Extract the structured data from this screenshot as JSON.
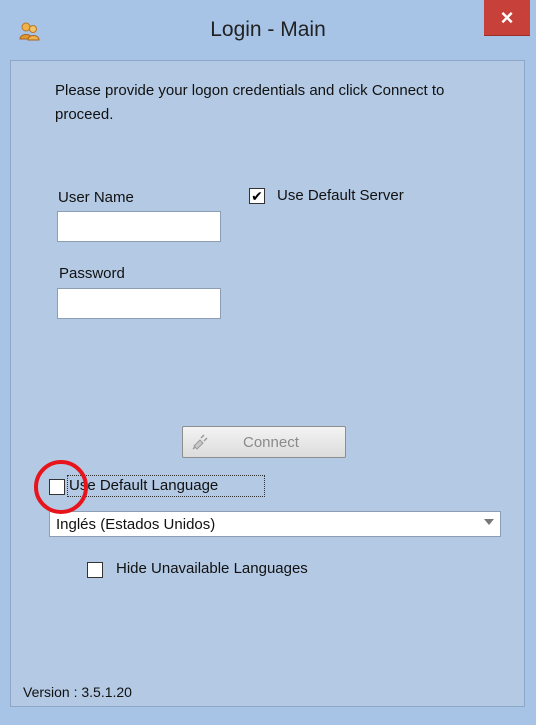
{
  "window": {
    "title": "Login - Main",
    "close_glyph": "×",
    "app_icon": "users-icon",
    "accent": "#a7c4e7",
    "close_color": "#c7413a"
  },
  "form": {
    "instructions": "Please provide your logon credentials and click Connect to proceed.",
    "username_label": "User Name",
    "username_value": "",
    "password_label": "Password",
    "password_value": "",
    "default_server_label": "Use Default Server",
    "default_server_checked": true,
    "connect_label": "Connect",
    "connect_enabled": false,
    "default_language_label": "Use Default Language",
    "default_language_checked": false,
    "language_selected": "Inglés (Estados Unidos)",
    "hide_unavailable_label": "Hide Unavailable Languages",
    "hide_unavailable_checked": false
  },
  "footer": {
    "version": "Version : 3.5.1.20"
  },
  "annotation": {
    "highlight_color": "#e8141b"
  }
}
